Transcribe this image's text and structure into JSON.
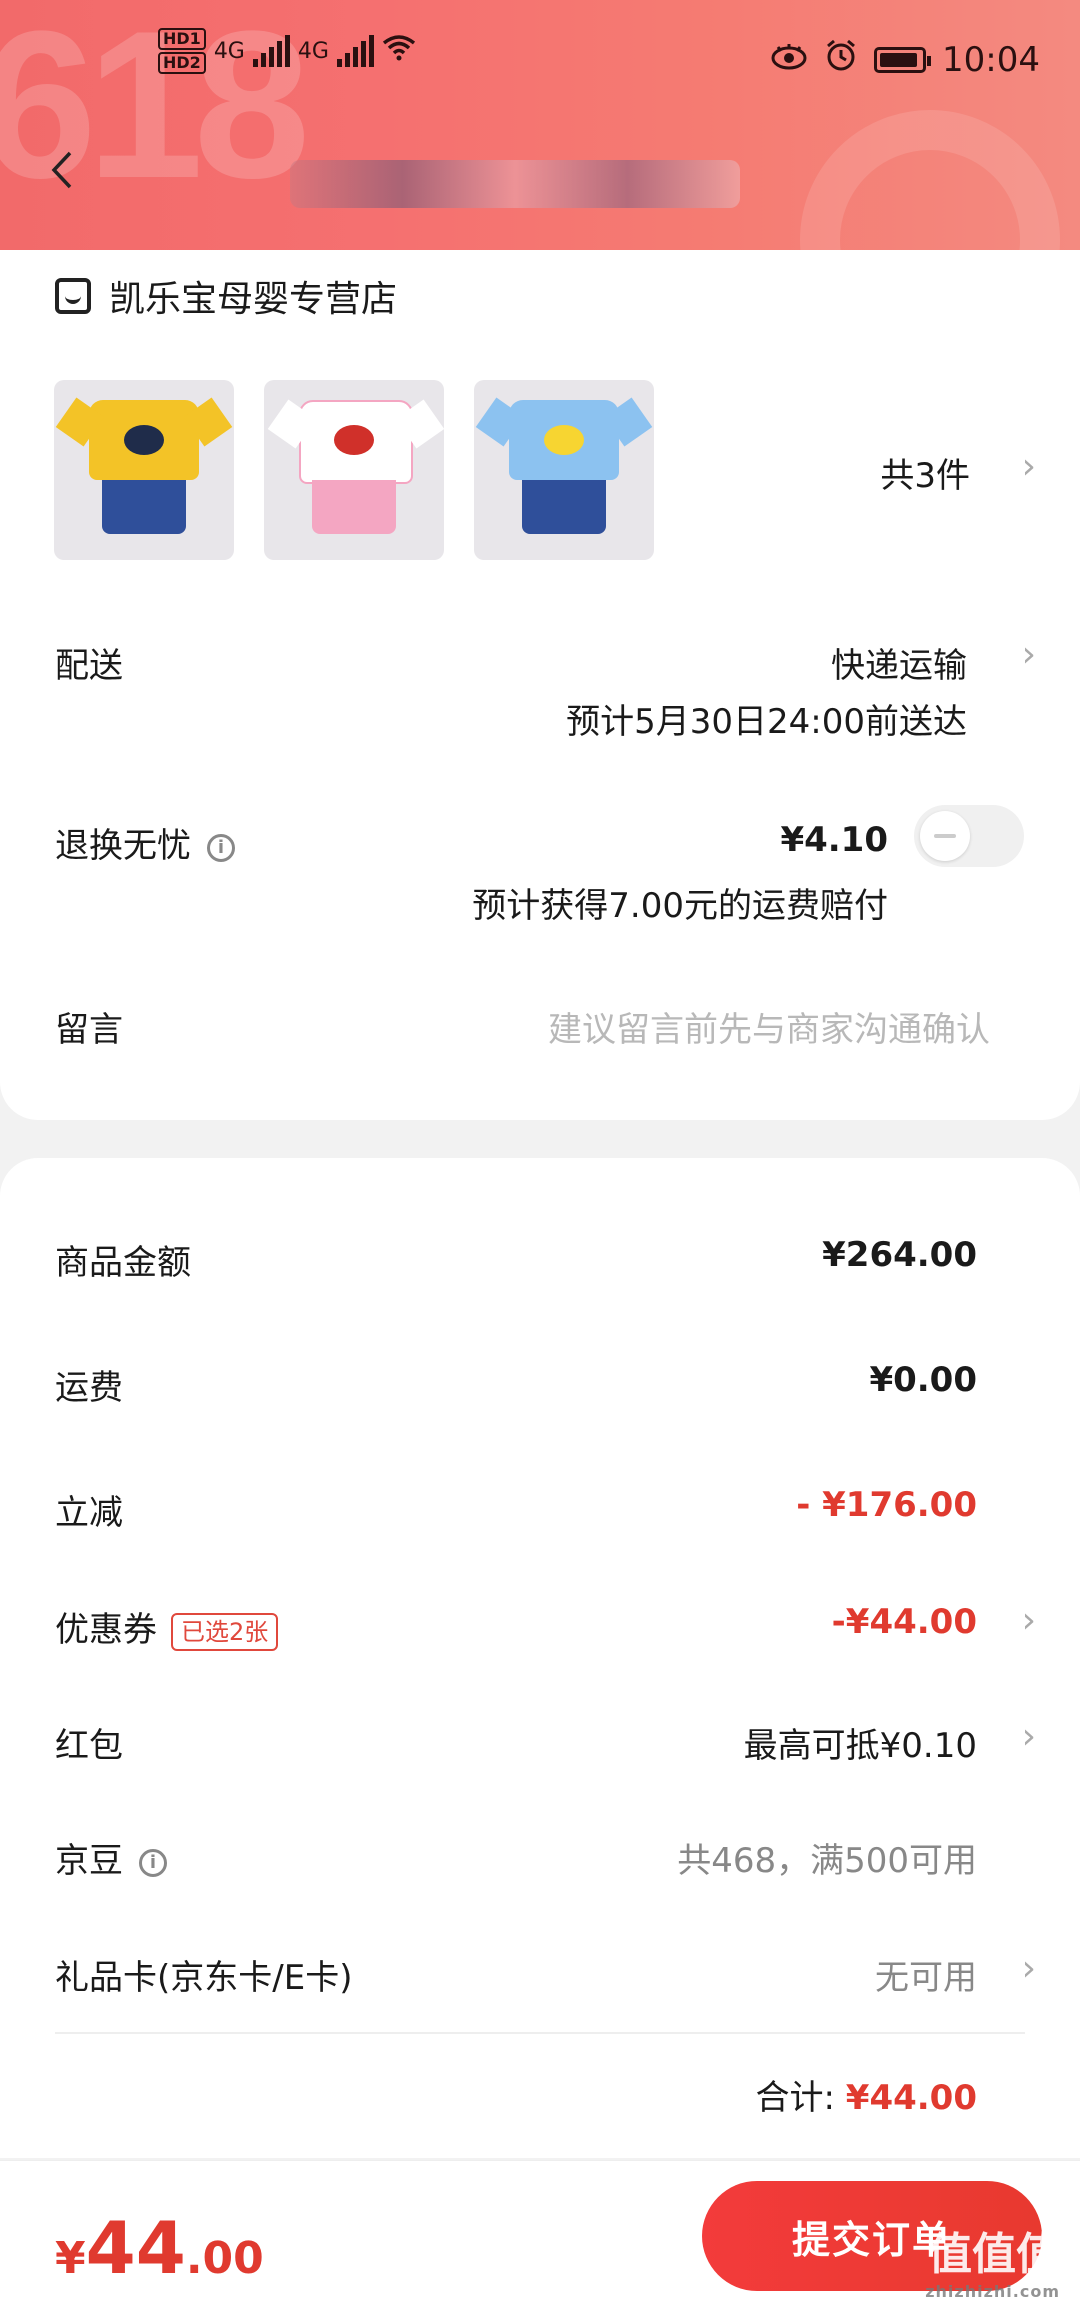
{
  "status_bar": {
    "hd1": "HD1",
    "hd2": "HD2",
    "net1": "4G",
    "net2": "4G",
    "time": "10:04"
  },
  "header": {
    "bg_text": "618",
    "back_icon": "chevron-left-icon"
  },
  "shop": {
    "name": "凯乐宝母婴专营店",
    "icon": "shop-icon"
  },
  "products": {
    "count_label": "共3件",
    "items": [
      {
        "shirt_color": "#f3c327",
        "pants_color": "#2f4f9a",
        "logo_color": "#1f2c4a"
      },
      {
        "shirt_color": "#ffffff",
        "pants_color": "#f4a6c2",
        "logo_color": "#d0302a"
      },
      {
        "shirt_color": "#8cc2f0",
        "pants_color": "#2f4f9a",
        "logo_color": "#f7d531"
      }
    ]
  },
  "delivery": {
    "label": "配送",
    "method": "快递运输",
    "eta": "预计5月30日24:00前送达"
  },
  "return_worry_free": {
    "label": "退换无忧",
    "info_icon": "info-icon",
    "price": "¥4.10",
    "note": "预计获得7.00元的运费赔付",
    "enabled": false
  },
  "message": {
    "label": "留言",
    "placeholder": "建议留言前先与商家沟通确认"
  },
  "pricing": {
    "goods_label": "商品金额",
    "goods_value": "¥264.00",
    "shipping_label": "运费",
    "shipping_value": "¥0.00",
    "discount_label": "立减",
    "discount_value": "- ¥176.00",
    "coupon_label": "优惠券",
    "coupon_tag": "已选2张",
    "coupon_value": "-¥44.00",
    "redpacket_label": "红包",
    "redpacket_value": "最高可抵¥0.10",
    "jingdou_label": "京豆",
    "jingdou_value": "共468，满500可用",
    "giftcard_label": "礼品卡(京东卡/E卡)",
    "giftcard_value": "无可用",
    "total_label": "合计:",
    "total_value": "¥44.00"
  },
  "bottom_bar": {
    "currency": "¥",
    "price_int": "44",
    "price_dec": ".00",
    "submit_label": "提交订单",
    "watermark": "值值值",
    "watermark_url": "zhizhizhi.com"
  },
  "colors": {
    "accent_red": "#e03a2f",
    "header_red": "#f26a6a"
  }
}
